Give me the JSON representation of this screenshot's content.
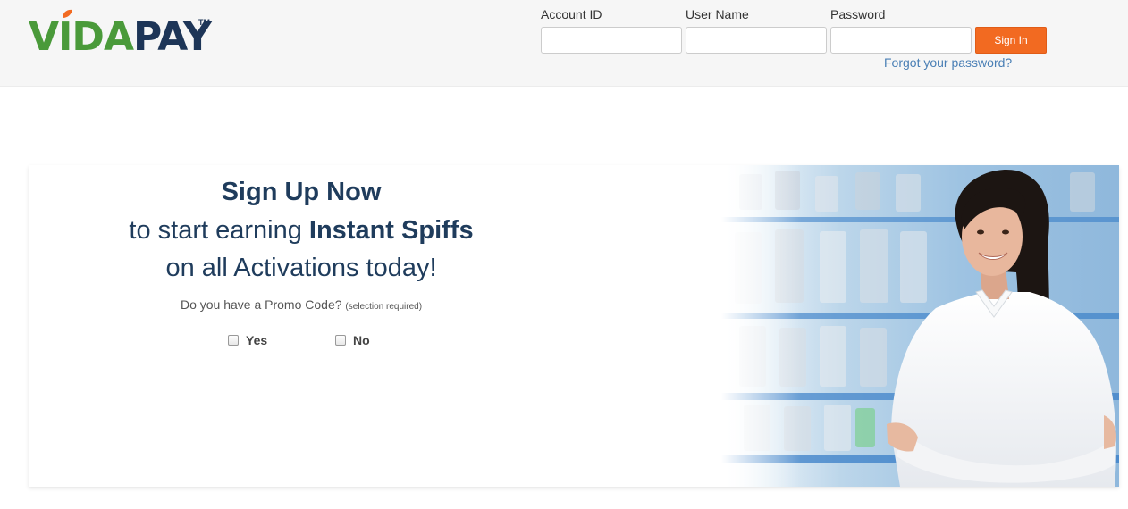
{
  "brand": {
    "vida": "VIDA",
    "pay": "PAY",
    "tm": "TM"
  },
  "login": {
    "account_label": "Account ID",
    "username_label": "User Name",
    "password_label": "Password",
    "signin_label": "Sign In",
    "forgot_label": "Forgot your password?"
  },
  "promo": {
    "headline": "Sign Up Now",
    "line2_prefix": "to start earning ",
    "line2_bold": "Instant Spiffs",
    "line3": "on all Activations today!",
    "question": "Do you have a Promo Code? ",
    "question_note": "(selection required)",
    "options": [
      "Yes",
      "No"
    ]
  },
  "colors": {
    "brand_green": "#4a9a3a",
    "brand_navy": "#1d3557",
    "accent_orange": "#f26a21",
    "link_blue": "#4a7fb5"
  }
}
